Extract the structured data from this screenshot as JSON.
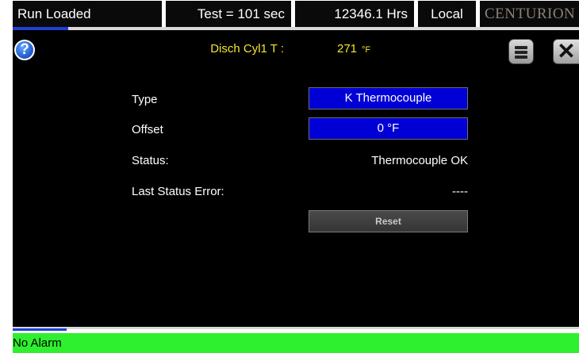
{
  "topbar": {
    "run_state": "Run Loaded",
    "test_time": "Test = 101 sec",
    "hours": "12346.1 Hrs",
    "mode": "Local",
    "brand": "CENTURION"
  },
  "header": {
    "sensor_name": "Disch Cyl1 T :",
    "sensor_value": "271",
    "sensor_unit": "°F",
    "icons": {
      "help": "help-icon",
      "menu": "menu-icon",
      "close": "close-icon"
    },
    "close_glyph": "✕",
    "help_glyph": "?"
  },
  "settings": {
    "type_label": "Type",
    "type_value": "K Thermocouple",
    "offset_label": "Offset",
    "offset_value": "0   °F",
    "status_label": "Status:",
    "status_value": "Thermocouple OK",
    "last_error_label": "Last Status Error:",
    "last_error_value": "----",
    "reset_label": "Reset"
  },
  "alarm": {
    "text": "No Alarm"
  },
  "colors": {
    "highlight_yellow": "#f0e62a",
    "field_blue": "#0000d6",
    "alarm_green": "#2ef02e",
    "panel_black": "#000000"
  }
}
